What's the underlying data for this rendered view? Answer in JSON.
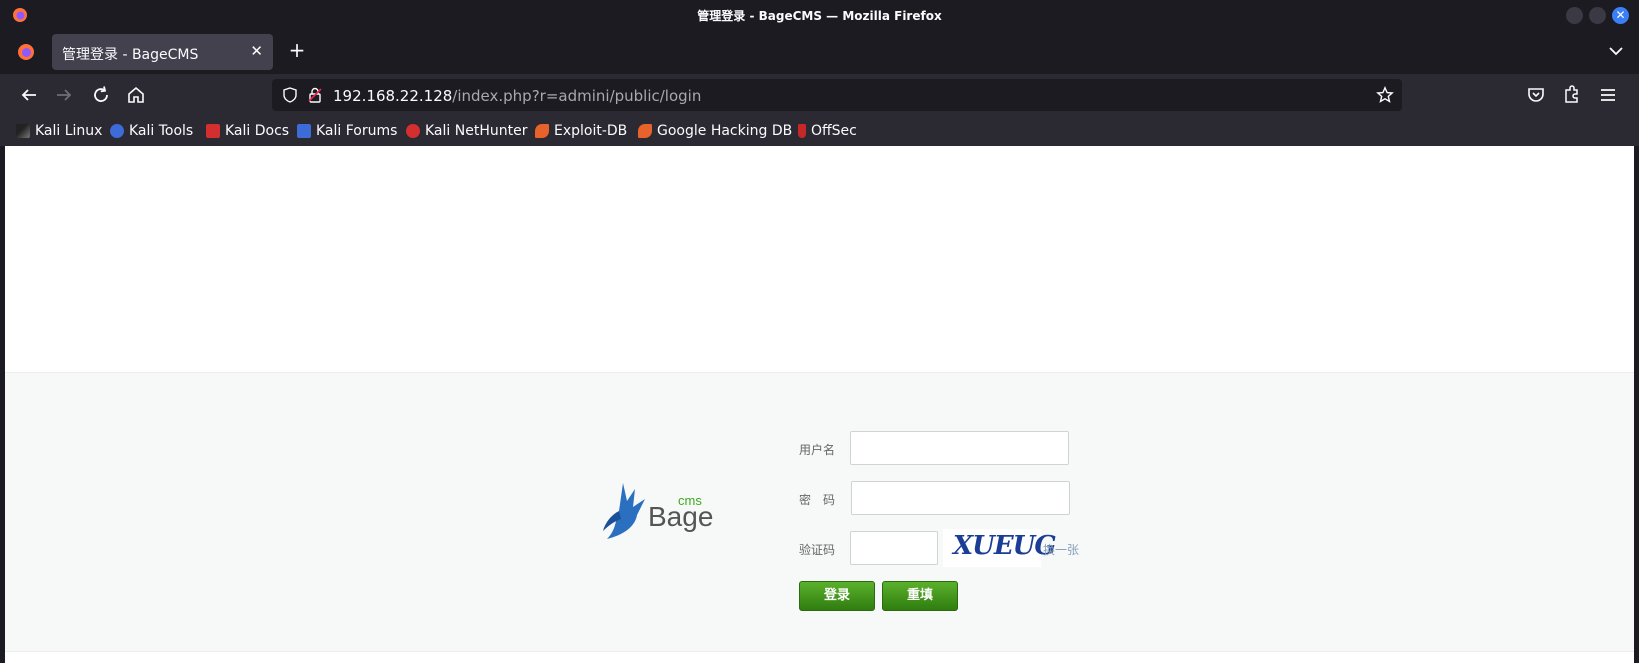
{
  "window": {
    "title": "管理登录 - BageCMS — Mozilla Firefox"
  },
  "tab": {
    "label": "管理登录 - BageCMS"
  },
  "urlbar": {
    "host": "192.168.22.128",
    "path": "/index.php?r=admini/public/login"
  },
  "bookmarks": [
    {
      "label": "Kali Linux",
      "icon": "kali-dragon-icon",
      "color": "#1a1a1a"
    },
    {
      "label": "Kali Tools",
      "icon": "kali-tools-icon",
      "color": "#3d6bd8"
    },
    {
      "label": "Kali Docs",
      "icon": "kali-docs-icon",
      "color": "#d32f2f"
    },
    {
      "label": "Kali Forums",
      "icon": "kali-forums-icon",
      "color": "#3d6bd8"
    },
    {
      "label": "Kali NetHunter",
      "icon": "kali-nethunter-icon",
      "color": "#d32f2f"
    },
    {
      "label": "Exploit-DB",
      "icon": "exploit-db-icon",
      "color": "#e8632c"
    },
    {
      "label": "Google Hacking DB",
      "icon": "ghdb-icon",
      "color": "#e8632c"
    },
    {
      "label": "OffSec",
      "icon": "offsec-icon",
      "color": "#c62828"
    }
  ],
  "login": {
    "logo_text": "Bage",
    "logo_sub": "cms",
    "username_label": "用户名",
    "password_label": "密　码",
    "captcha_label": "验证码",
    "captcha_text": "XUEUG",
    "refresh_label": "换一张",
    "login_button": "登录",
    "reset_button": "重填",
    "username_value": "",
    "password_value": "",
    "captcha_value": ""
  },
  "colors": {
    "accent_green": "#3f9a1a",
    "page_band": "#f7f8f8",
    "browser_chrome": "#2b2a33"
  }
}
